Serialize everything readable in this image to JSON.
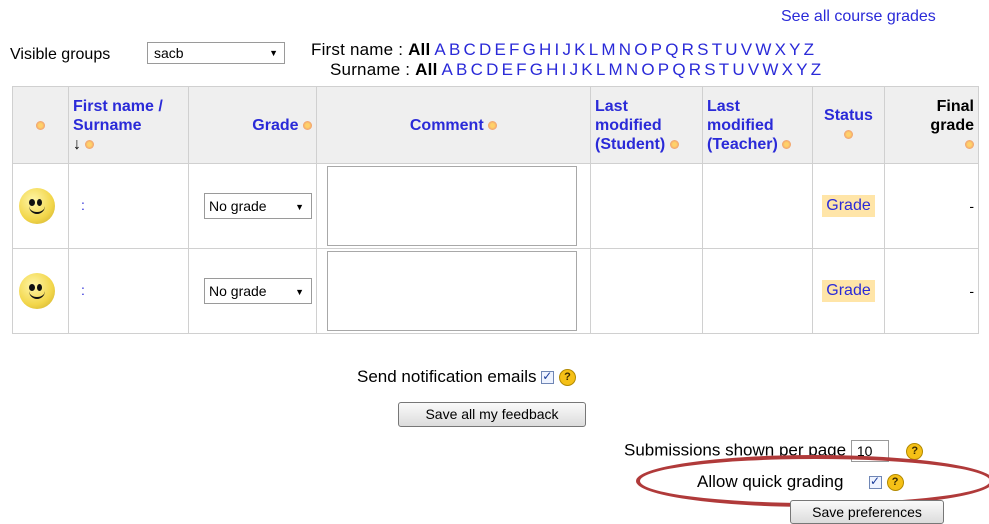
{
  "top_link": "See all course grades",
  "groups": {
    "label": "Visible groups",
    "selected": "sacb"
  },
  "initials": {
    "firstname_label": "First name :",
    "surname_label": "Surname :",
    "all": "All",
    "letters": [
      "A",
      "B",
      "C",
      "D",
      "E",
      "F",
      "G",
      "H",
      "I",
      "J",
      "K",
      "L",
      "M",
      "N",
      "O",
      "P",
      "Q",
      "R",
      "S",
      "T",
      "U",
      "V",
      "W",
      "X",
      "Y",
      "Z"
    ]
  },
  "table": {
    "headers": {
      "name": "First name / Surname",
      "sort_arrow": "↓",
      "grade": "Grade",
      "comment": "Comment",
      "last_mod_student": "Last modified (Student)",
      "last_mod_teacher": "Last modified (Teacher)",
      "status": "Status",
      "final_grade": "Final grade"
    },
    "rows": [
      {
        "name": ":",
        "grade": "No grade",
        "comment": "",
        "status": "Grade",
        "final_grade": "-"
      },
      {
        "name": ":",
        "grade": "No grade",
        "comment": "",
        "status": "Grade",
        "final_grade": "-"
      }
    ]
  },
  "options": {
    "send_notifications_label": "Send notification emails",
    "send_notifications_checked": true,
    "save_feedback_label": "Save all my feedback",
    "per_page_label": "Submissions shown per page",
    "per_page_value": "10",
    "quick_grading_label": "Allow quick grading",
    "quick_grading_checked": true,
    "save_preferences_label": "Save preferences"
  },
  "help_glyph": "?",
  "colors": {
    "link": "#2a2ad8",
    "status_bg": "#ffe5a8",
    "highlight": "#b03a3a"
  }
}
